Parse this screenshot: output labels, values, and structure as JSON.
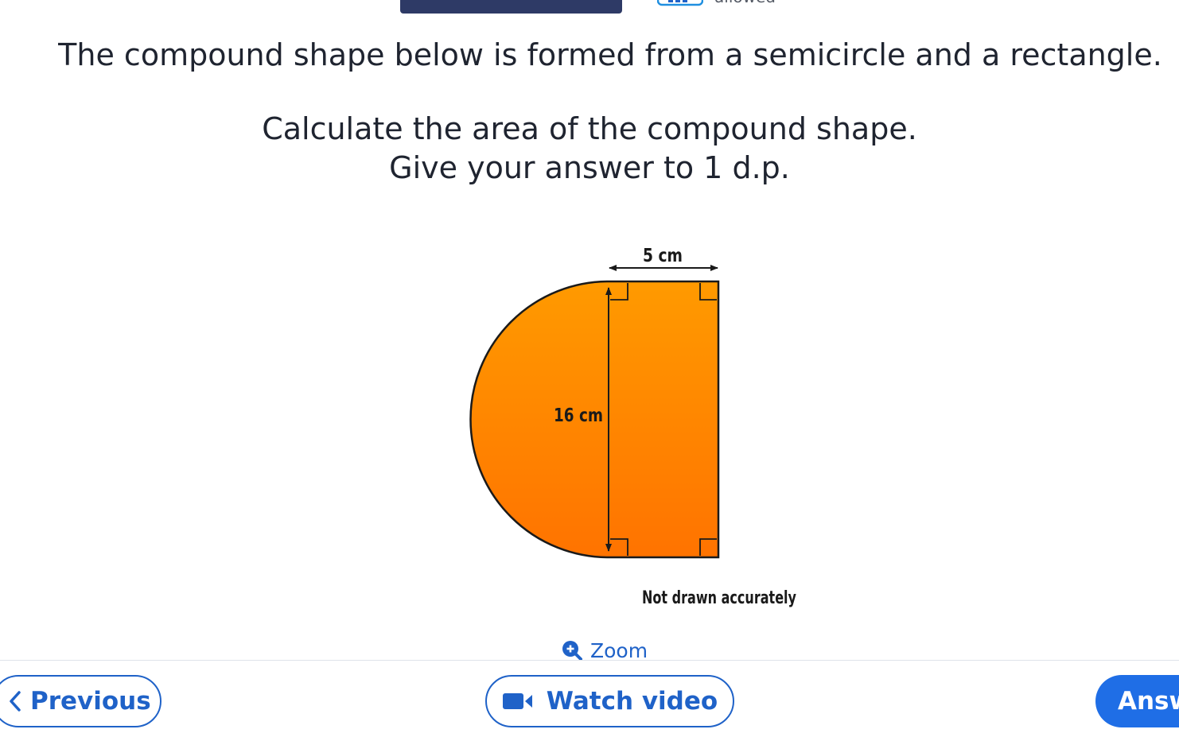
{
  "header": {
    "allowed_text": "allowed",
    "calculator_icon": "calculator-icon"
  },
  "question": {
    "line1": "The compound shape below is formed from a semicircle and a rectangle.",
    "line2": "Calculate the area of the compound shape.",
    "line3": "Give your answer to 1 d.p."
  },
  "diagram": {
    "width_label": "5 cm",
    "height_label": "16 cm",
    "note": "Not drawn accurately",
    "fill_top": "#ff9a00",
    "fill_bottom": "#ff7300",
    "stroke": "#1a1a1a"
  },
  "zoom": {
    "label": "Zoom",
    "icon": "zoom-in-icon"
  },
  "footer": {
    "previous_label": "Previous",
    "watch_video_label": "Watch video",
    "answer_label": "Answer",
    "accent": "#1f62c8",
    "answer_bg": "#1f6ee6"
  }
}
